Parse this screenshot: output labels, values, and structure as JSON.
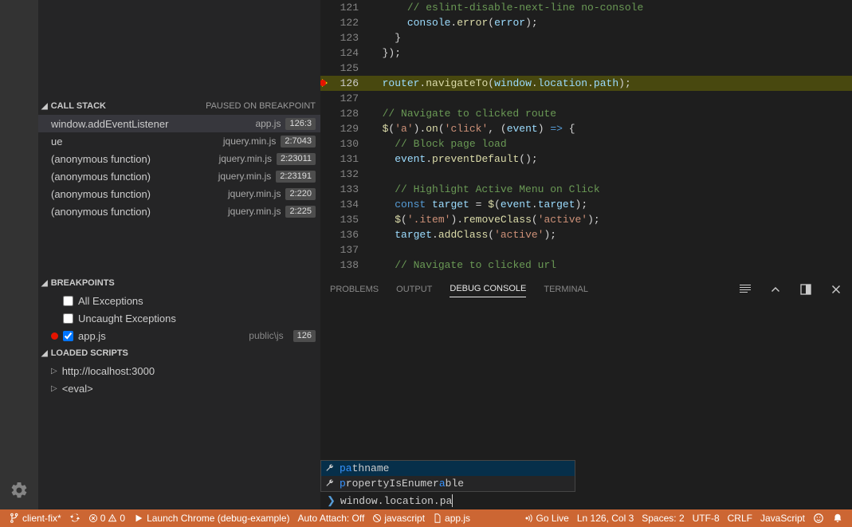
{
  "callstack": {
    "title": "CALL STACK",
    "status": "PAUSED ON BREAKPOINT",
    "frames": [
      {
        "fn": "window.addEventListener",
        "file": "app.js",
        "loc": "126:3",
        "sel": true
      },
      {
        "fn": "ue",
        "file": "jquery.min.js",
        "loc": "2:7043"
      },
      {
        "fn": "(anonymous function)",
        "file": "jquery.min.js",
        "loc": "2:23011"
      },
      {
        "fn": "(anonymous function)",
        "file": "jquery.min.js",
        "loc": "2:23191"
      },
      {
        "fn": "(anonymous function)",
        "file": "jquery.min.js",
        "loc": "2:220"
      },
      {
        "fn": "(anonymous function)",
        "file": "jquery.min.js",
        "loc": "2:225"
      }
    ]
  },
  "breakpoints": {
    "title": "BREAKPOINTS",
    "items": [
      {
        "label": "All Exceptions",
        "checked": false,
        "hasDot": false
      },
      {
        "label": "Uncaught Exceptions",
        "checked": false,
        "hasDot": false
      },
      {
        "label": "app.js",
        "path": "public\\js",
        "checked": true,
        "hasDot": true,
        "badge": "126"
      }
    ]
  },
  "loadedScripts": {
    "title": "LOADED SCRIPTS",
    "items": [
      {
        "label": "http://localhost:3000"
      },
      {
        "label": "<eval>"
      }
    ]
  },
  "editor": {
    "lines": [
      {
        "n": 121,
        "html": "      <span class='tok-com'>// eslint-disable-next-line no-console</span>"
      },
      {
        "n": 122,
        "html": "      <span class='tok-var'>console</span><span class='tok-id'>.</span><span class='tok-fn'>error</span><span class='tok-id'>(</span><span class='tok-var'>error</span><span class='tok-id'>);</span>"
      },
      {
        "n": 123,
        "html": "    <span class='tok-id'>}</span>"
      },
      {
        "n": 124,
        "html": "  <span class='tok-id'>});</span>"
      },
      {
        "n": 125,
        "html": ""
      },
      {
        "n": 126,
        "html": "  <span class='tok-var'>router</span><span class='tok-id'>.</span><span class='tok-fn'>navigateTo</span><span class='tok-id'>(</span><span class='tok-var'>window</span><span class='tok-id'>.</span><span class='tok-var'>location</span><span class='tok-id'>.</span><span class='tok-var'>path</span><span class='tok-id'>);</span>",
        "hl": true,
        "marker": true
      },
      {
        "n": 127,
        "html": ""
      },
      {
        "n": 128,
        "html": "  <span class='tok-com'>// Navigate to clicked route</span>"
      },
      {
        "n": 129,
        "html": "  <span class='tok-fn'>$</span><span class='tok-id'>(</span><span class='tok-str'>'a'</span><span class='tok-id'>).</span><span class='tok-fn'>on</span><span class='tok-id'>(</span><span class='tok-str'>'click'</span><span class='tok-id'>, (</span><span class='tok-var'>event</span><span class='tok-id'>) </span><span class='tok-kw'>=&gt;</span><span class='tok-id'> {</span>"
      },
      {
        "n": 130,
        "html": "    <span class='tok-com'>// Block page load</span>"
      },
      {
        "n": 131,
        "html": "    <span class='tok-var'>event</span><span class='tok-id'>.</span><span class='tok-fn'>preventDefault</span><span class='tok-id'>();</span>"
      },
      {
        "n": 132,
        "html": ""
      },
      {
        "n": 133,
        "html": "    <span class='tok-com'>// Highlight Active Menu on Click</span>"
      },
      {
        "n": 134,
        "html": "    <span class='tok-kw'>const</span><span class='tok-id'> </span><span class='tok-var'>target</span><span class='tok-id'> = </span><span class='tok-fn'>$</span><span class='tok-id'>(</span><span class='tok-var'>event</span><span class='tok-id'>.</span><span class='tok-var'>target</span><span class='tok-id'>);</span>"
      },
      {
        "n": 135,
        "html": "    <span class='tok-fn'>$</span><span class='tok-id'>(</span><span class='tok-str'>'.item'</span><span class='tok-id'>).</span><span class='tok-fn'>removeClass</span><span class='tok-id'>(</span><span class='tok-str'>'active'</span><span class='tok-id'>);</span>"
      },
      {
        "n": 136,
        "html": "    <span class='tok-var'>target</span><span class='tok-id'>.</span><span class='tok-fn'>addClass</span><span class='tok-id'>(</span><span class='tok-str'>'active'</span><span class='tok-id'>);</span>"
      },
      {
        "n": 137,
        "html": ""
      },
      {
        "n": 138,
        "html": "    <span class='tok-com'>// Navigate to clicked url</span>"
      }
    ]
  },
  "panel": {
    "tabs": [
      "PROBLEMS",
      "OUTPUT",
      "DEBUG CONSOLE",
      "TERMINAL"
    ],
    "active": 2,
    "suggestions": [
      {
        "pre": "pa",
        "rest": "thname",
        "sel": true
      },
      {
        "pre": "p",
        "mid": "ropertyIsEnumer",
        "m2": "a",
        "rest": "ble"
      }
    ],
    "replInput": "window.location.pa"
  },
  "status": {
    "branch": "client-fix*",
    "errors": "0",
    "warnings": "0",
    "launch": "Launch Chrome (debug-example)",
    "autoAttach": "Auto Attach: Off",
    "lang1": "javascript",
    "file": "app.js",
    "golive": "Go Live",
    "pos": "Ln 126, Col 3",
    "spaces": "Spaces: 2",
    "enc": "UTF-8",
    "eol": "CRLF",
    "mode": "JavaScript"
  }
}
